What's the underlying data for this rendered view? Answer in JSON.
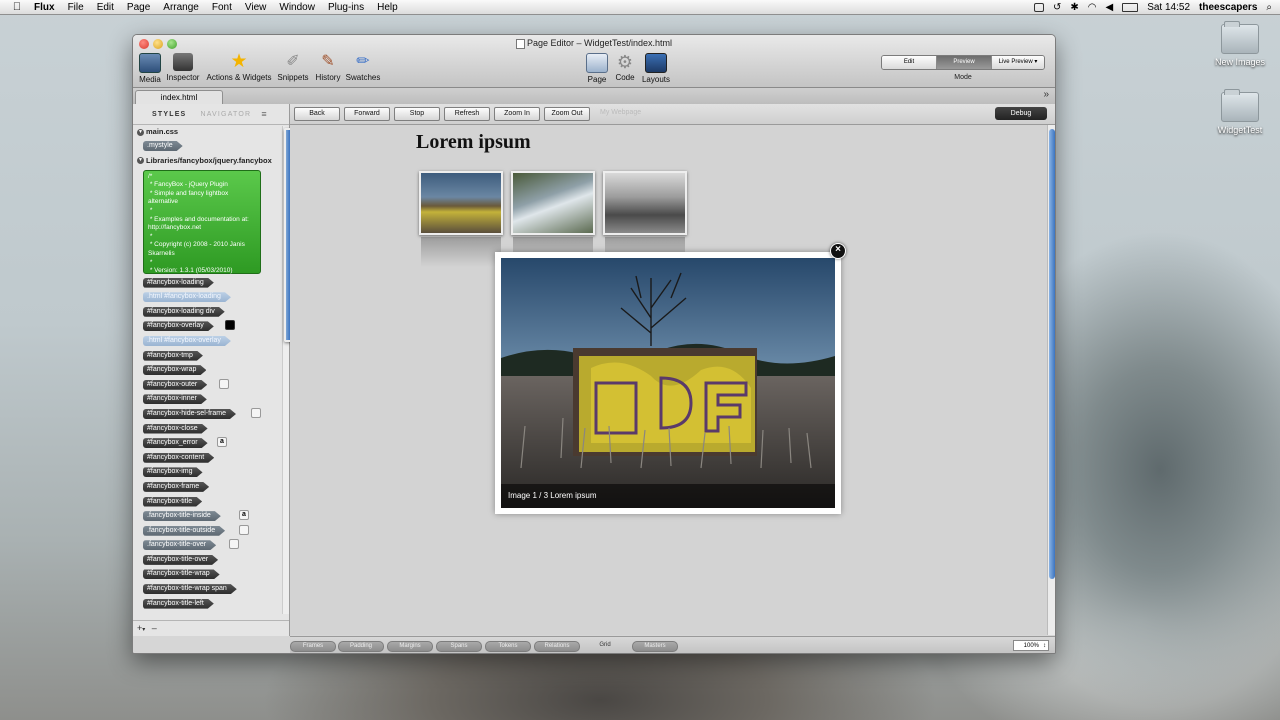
{
  "menubar": {
    "app_name": "Flux",
    "items": [
      "File",
      "Edit",
      "Page",
      "Arrange",
      "Font",
      "View",
      "Window",
      "Plug-ins",
      "Help"
    ],
    "clock": "Sat 14:52",
    "user": "theescapers"
  },
  "desktop": {
    "folders": [
      {
        "label": "New Images"
      },
      {
        "label": "WidgetTest"
      }
    ]
  },
  "window": {
    "title": "Page Editor – WidgetTest/index.html",
    "tools_left": [
      {
        "label": "Media",
        "icon": "media-icon"
      },
      {
        "label": "Inspector",
        "icon": "inspector-icon"
      },
      {
        "label": "Actions & Widgets",
        "icon": "star-icon"
      },
      {
        "label": "Snippets",
        "icon": "paperclip-icon"
      },
      {
        "label": "History",
        "icon": "history-icon"
      },
      {
        "label": "Swatches",
        "icon": "brush-icon"
      }
    ],
    "tools_center": [
      {
        "label": "Page",
        "icon": "page-icon"
      },
      {
        "label": "Code",
        "icon": "gear-icon"
      },
      {
        "label": "Layouts",
        "icon": "layouts-icon"
      }
    ],
    "mode": {
      "options": [
        "Edit",
        "Preview",
        "Live Preview"
      ],
      "selected": "Preview",
      "label": "Mode"
    },
    "tab": "index.html"
  },
  "left_panel": {
    "header_styles": "STYLES",
    "header_navigator": "NAVIGATOR",
    "file1": "main.css",
    "file1_rules": [
      ".mystyle"
    ],
    "file2": "Libraries/fancybox/jquery.fancybox",
    "comment": "/*\n * FancyBox - jQuery Plugin\n * Simple and fancy lightbox alternative\n *\n * Examples and documentation at: http://fancybox.net\n *\n * Copyright (c) 2008 - 2010 Janis Skarnelis\n *\n * Version: 1.3.1 (05/03/2010)",
    "rules": [
      {
        "name": "#fancybox-loading",
        "style": "dark",
        "swatch": ""
      },
      {
        "name": ".html #fancybox-loading",
        "style": "light",
        "swatch": ""
      },
      {
        "name": "#fancybox-loading div",
        "style": "dark",
        "swatch": ""
      },
      {
        "name": "#fancybox-overlay",
        "style": "dark",
        "swatch": "black"
      },
      {
        "name": ".html #fancybox-overlay",
        "style": "light",
        "swatch": ""
      },
      {
        "name": "#fancybox-tmp",
        "style": "dark",
        "swatch": ""
      },
      {
        "name": "#fancybox-wrap",
        "style": "dark",
        "swatch": ""
      },
      {
        "name": "#fancybox-outer",
        "style": "dark",
        "swatch": "white"
      },
      {
        "name": "#fancybox-inner",
        "style": "dark",
        "swatch": ""
      },
      {
        "name": "#fancybox-hide-sel-frame",
        "style": "dark",
        "swatch": "white"
      },
      {
        "name": "#fancybox-close",
        "style": "dark",
        "swatch": ""
      },
      {
        "name": "#fancybox_error",
        "style": "dark",
        "swatch": "a"
      },
      {
        "name": "#fancybox-content",
        "style": "dark",
        "swatch": ""
      },
      {
        "name": "#fancybox-img",
        "style": "dark",
        "swatch": ""
      },
      {
        "name": "#fancybox-frame",
        "style": "dark",
        "swatch": ""
      },
      {
        "name": "#fancybox-title",
        "style": "dark",
        "swatch": ""
      },
      {
        "name": ".fancybox-title-inside",
        "style": "grey",
        "swatch": "a"
      },
      {
        "name": ".fancybox-title-outside",
        "style": "grey",
        "swatch": "white"
      },
      {
        "name": ".fancybox-title-over",
        "style": "grey",
        "swatch": "white"
      },
      {
        "name": "#fancybox-title-over",
        "style": "dark",
        "swatch": ""
      },
      {
        "name": "#fancybox-title-wrap",
        "style": "dark",
        "swatch": ""
      },
      {
        "name": "#fancybox-title-wrap span",
        "style": "dark",
        "swatch": ""
      },
      {
        "name": "#fancybox-title-left",
        "style": "dark",
        "swatch": ""
      }
    ],
    "swatch_letter": "a",
    "footer_add": "+",
    "footer_remove": "–"
  },
  "navbar": {
    "buttons": [
      "Back",
      "Forward",
      "Stop",
      "Refresh",
      "Zoom In",
      "Zoom Out"
    ],
    "site": "My Webpage",
    "debug": "Debug"
  },
  "content": {
    "heading": "Lorem ipsum",
    "lightbox_caption": "Image 1 / 3   Lorem ipsum",
    "close_symbol": "×"
  },
  "bottombar": {
    "items": [
      "Frames",
      "Padding",
      "Margins",
      "Spans",
      "Tokens",
      "Relations",
      "Grid",
      "Masters"
    ],
    "active": "Grid",
    "zoom": "100%"
  }
}
